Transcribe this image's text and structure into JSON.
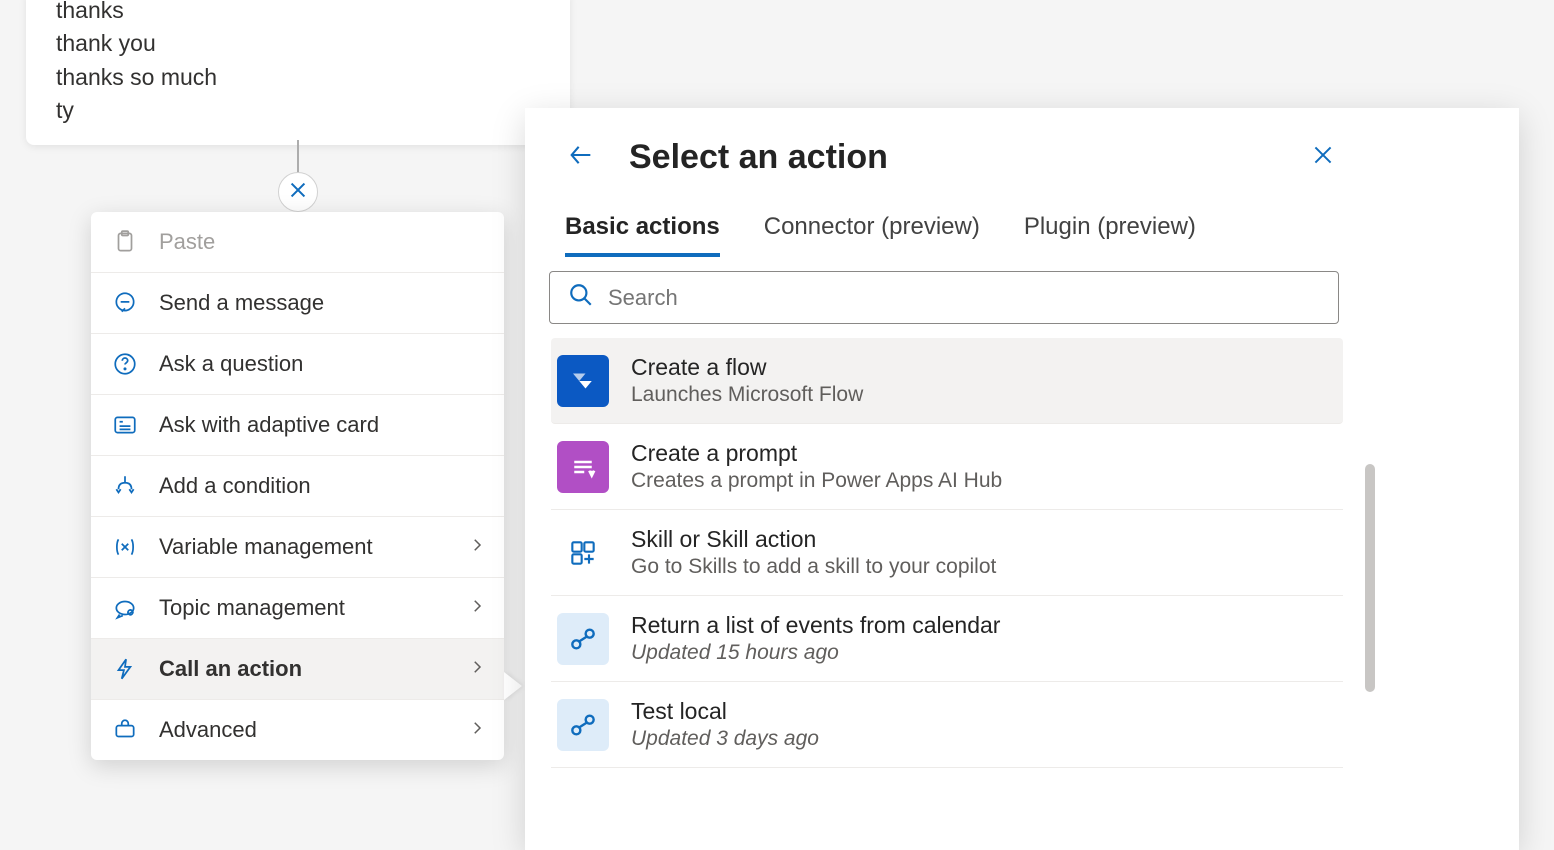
{
  "phrases": [
    "thanks",
    "thank you",
    "thanks so much",
    "ty"
  ],
  "context_menu": {
    "items": [
      {
        "label": "Paste",
        "icon": "clipboard-icon",
        "disabled": true,
        "has_submenu": false
      },
      {
        "label": "Send a message",
        "icon": "message-icon",
        "disabled": false,
        "has_submenu": false
      },
      {
        "label": "Ask a question",
        "icon": "question-icon",
        "disabled": false,
        "has_submenu": false
      },
      {
        "label": "Ask with adaptive card",
        "icon": "card-icon",
        "disabled": false,
        "has_submenu": false
      },
      {
        "label": "Add a condition",
        "icon": "branch-icon",
        "disabled": false,
        "has_submenu": false
      },
      {
        "label": "Variable management",
        "icon": "variable-icon",
        "disabled": false,
        "has_submenu": true
      },
      {
        "label": "Topic management",
        "icon": "topic-icon",
        "disabled": false,
        "has_submenu": true
      },
      {
        "label": "Call an action",
        "icon": "action-icon",
        "disabled": false,
        "has_submenu": true,
        "highlighted": true
      },
      {
        "label": "Advanced",
        "icon": "advanced-icon",
        "disabled": false,
        "has_submenu": true
      }
    ]
  },
  "panel": {
    "title": "Select an action",
    "tabs": [
      {
        "label": "Basic actions",
        "active": true
      },
      {
        "label": "Connector (preview)",
        "active": false
      },
      {
        "label": "Plugin (preview)",
        "active": false
      }
    ],
    "search_placeholder": "Search",
    "actions": [
      {
        "title": "Create a flow",
        "subtitle": "Launches Microsoft Flow",
        "icon_style": "flow",
        "highlight": true,
        "italic": false
      },
      {
        "title": "Create a prompt",
        "subtitle": "Creates a prompt in Power Apps AI Hub",
        "icon_style": "prompt",
        "highlight": false,
        "italic": false
      },
      {
        "title": "Skill or Skill action",
        "subtitle": "Go to Skills to add a skill to your copilot",
        "icon_style": "skill",
        "highlight": false,
        "italic": false
      },
      {
        "title": "Return a list of events from calendar",
        "subtitle": "Updated 15 hours ago",
        "icon_style": "custom",
        "highlight": false,
        "italic": true
      },
      {
        "title": "Test local",
        "subtitle": "Updated 3 days ago",
        "icon_style": "custom",
        "highlight": false,
        "italic": true
      }
    ]
  }
}
